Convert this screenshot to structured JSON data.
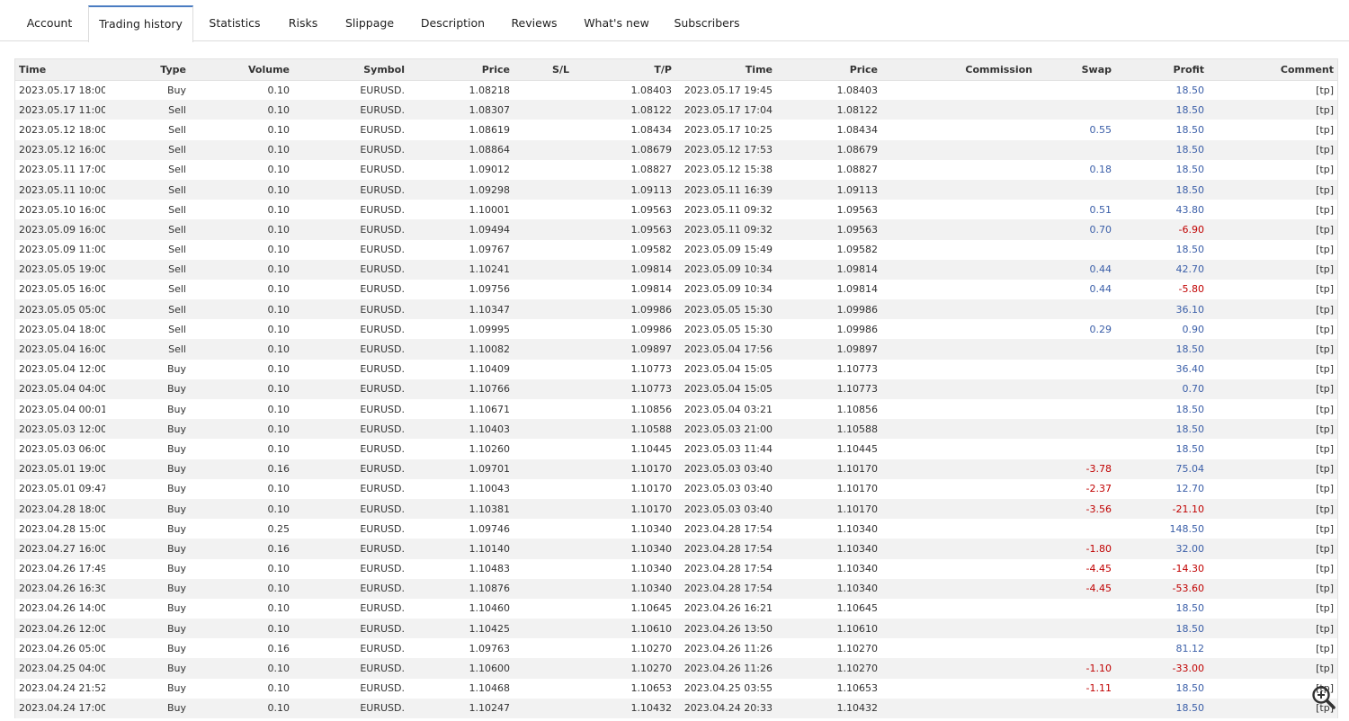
{
  "tabs": [
    {
      "label": "Account",
      "active": false
    },
    {
      "label": "Trading history",
      "active": true
    },
    {
      "label": "Statistics",
      "active": false
    },
    {
      "label": "Risks",
      "active": false
    },
    {
      "label": "Slippage",
      "active": false
    },
    {
      "label": "Description",
      "active": false
    },
    {
      "label": "Reviews",
      "active": false
    },
    {
      "label": "What's new",
      "active": false
    },
    {
      "label": "Subscribers",
      "active": false
    }
  ],
  "table": {
    "columns": [
      "Time",
      "Type",
      "Volume",
      "Symbol",
      "Price",
      "S/L",
      "T/P",
      "Time",
      "Price",
      "Commission",
      "Swap",
      "Profit",
      "Comment"
    ],
    "rows": [
      [
        "2023.05.17 18:00",
        "Buy",
        "0.10",
        "EURUSD.",
        "1.08218",
        "",
        "1.08403",
        "2023.05.17 19:45",
        "1.08403",
        "",
        "",
        "18.50",
        "[tp]"
      ],
      [
        "2023.05.17 11:00",
        "Sell",
        "0.10",
        "EURUSD.",
        "1.08307",
        "",
        "1.08122",
        "2023.05.17 17:04",
        "1.08122",
        "",
        "",
        "18.50",
        "[tp]"
      ],
      [
        "2023.05.12 18:00",
        "Sell",
        "0.10",
        "EURUSD.",
        "1.08619",
        "",
        "1.08434",
        "2023.05.17 10:25",
        "1.08434",
        "",
        "0.55",
        "18.50",
        "[tp]"
      ],
      [
        "2023.05.12 16:00",
        "Sell",
        "0.10",
        "EURUSD.",
        "1.08864",
        "",
        "1.08679",
        "2023.05.12 17:53",
        "1.08679",
        "",
        "",
        "18.50",
        "[tp]"
      ],
      [
        "2023.05.11 17:00",
        "Sell",
        "0.10",
        "EURUSD.",
        "1.09012",
        "",
        "1.08827",
        "2023.05.12 15:38",
        "1.08827",
        "",
        "0.18",
        "18.50",
        "[tp]"
      ],
      [
        "2023.05.11 10:00",
        "Sell",
        "0.10",
        "EURUSD.",
        "1.09298",
        "",
        "1.09113",
        "2023.05.11 16:39",
        "1.09113",
        "",
        "",
        "18.50",
        "[tp]"
      ],
      [
        "2023.05.10 16:00",
        "Sell",
        "0.10",
        "EURUSD.",
        "1.10001",
        "",
        "1.09563",
        "2023.05.11 09:32",
        "1.09563",
        "",
        "0.51",
        "43.80",
        "[tp]"
      ],
      [
        "2023.05.09 16:00",
        "Sell",
        "0.10",
        "EURUSD.",
        "1.09494",
        "",
        "1.09563",
        "2023.05.11 09:32",
        "1.09563",
        "",
        "0.70",
        "-6.90",
        "[tp]"
      ],
      [
        "2023.05.09 11:00",
        "Sell",
        "0.10",
        "EURUSD.",
        "1.09767",
        "",
        "1.09582",
        "2023.05.09 15:49",
        "1.09582",
        "",
        "",
        "18.50",
        "[tp]"
      ],
      [
        "2023.05.05 19:00",
        "Sell",
        "0.10",
        "EURUSD.",
        "1.10241",
        "",
        "1.09814",
        "2023.05.09 10:34",
        "1.09814",
        "",
        "0.44",
        "42.70",
        "[tp]"
      ],
      [
        "2023.05.05 16:00",
        "Sell",
        "0.10",
        "EURUSD.",
        "1.09756",
        "",
        "1.09814",
        "2023.05.09 10:34",
        "1.09814",
        "",
        "0.44",
        "-5.80",
        "[tp]"
      ],
      [
        "2023.05.05 05:00",
        "Sell",
        "0.10",
        "EURUSD.",
        "1.10347",
        "",
        "1.09986",
        "2023.05.05 15:30",
        "1.09986",
        "",
        "",
        "36.10",
        "[tp]"
      ],
      [
        "2023.05.04 18:00",
        "Sell",
        "0.10",
        "EURUSD.",
        "1.09995",
        "",
        "1.09986",
        "2023.05.05 15:30",
        "1.09986",
        "",
        "0.29",
        "0.90",
        "[tp]"
      ],
      [
        "2023.05.04 16:00",
        "Sell",
        "0.10",
        "EURUSD.",
        "1.10082",
        "",
        "1.09897",
        "2023.05.04 17:56",
        "1.09897",
        "",
        "",
        "18.50",
        "[tp]"
      ],
      [
        "2023.05.04 12:00",
        "Buy",
        "0.10",
        "EURUSD.",
        "1.10409",
        "",
        "1.10773",
        "2023.05.04 15:05",
        "1.10773",
        "",
        "",
        "36.40",
        "[tp]"
      ],
      [
        "2023.05.04 04:00",
        "Buy",
        "0.10",
        "EURUSD.",
        "1.10766",
        "",
        "1.10773",
        "2023.05.04 15:05",
        "1.10773",
        "",
        "",
        "0.70",
        "[tp]"
      ],
      [
        "2023.05.04 00:01",
        "Buy",
        "0.10",
        "EURUSD.",
        "1.10671",
        "",
        "1.10856",
        "2023.05.04 03:21",
        "1.10856",
        "",
        "",
        "18.50",
        "[tp]"
      ],
      [
        "2023.05.03 12:00",
        "Buy",
        "0.10",
        "EURUSD.",
        "1.10403",
        "",
        "1.10588",
        "2023.05.03 21:00",
        "1.10588",
        "",
        "",
        "18.50",
        "[tp]"
      ],
      [
        "2023.05.03 06:00",
        "Buy",
        "0.10",
        "EURUSD.",
        "1.10260",
        "",
        "1.10445",
        "2023.05.03 11:44",
        "1.10445",
        "",
        "",
        "18.50",
        "[tp]"
      ],
      [
        "2023.05.01 19:00",
        "Buy",
        "0.16",
        "EURUSD.",
        "1.09701",
        "",
        "1.10170",
        "2023.05.03 03:40",
        "1.10170",
        "",
        "-3.78",
        "75.04",
        "[tp]"
      ],
      [
        "2023.05.01 09:47",
        "Buy",
        "0.10",
        "EURUSD.",
        "1.10043",
        "",
        "1.10170",
        "2023.05.03 03:40",
        "1.10170",
        "",
        "-2.37",
        "12.70",
        "[tp]"
      ],
      [
        "2023.04.28 18:00",
        "Buy",
        "0.10",
        "EURUSD.",
        "1.10381",
        "",
        "1.10170",
        "2023.05.03 03:40",
        "1.10170",
        "",
        "-3.56",
        "-21.10",
        "[tp]"
      ],
      [
        "2023.04.28 15:00",
        "Buy",
        "0.25",
        "EURUSD.",
        "1.09746",
        "",
        "1.10340",
        "2023.04.28 17:54",
        "1.10340",
        "",
        "",
        "148.50",
        "[tp]"
      ],
      [
        "2023.04.27 16:00",
        "Buy",
        "0.16",
        "EURUSD.",
        "1.10140",
        "",
        "1.10340",
        "2023.04.28 17:54",
        "1.10340",
        "",
        "-1.80",
        "32.00",
        "[tp]"
      ],
      [
        "2023.04.26 17:49",
        "Buy",
        "0.10",
        "EURUSD.",
        "1.10483",
        "",
        "1.10340",
        "2023.04.28 17:54",
        "1.10340",
        "",
        "-4.45",
        "-14.30",
        "[tp]"
      ],
      [
        "2023.04.26 16:30",
        "Buy",
        "0.10",
        "EURUSD.",
        "1.10876",
        "",
        "1.10340",
        "2023.04.28 17:54",
        "1.10340",
        "",
        "-4.45",
        "-53.60",
        "[tp]"
      ],
      [
        "2023.04.26 14:00",
        "Buy",
        "0.10",
        "EURUSD.",
        "1.10460",
        "",
        "1.10645",
        "2023.04.26 16:21",
        "1.10645",
        "",
        "",
        "18.50",
        "[tp]"
      ],
      [
        "2023.04.26 12:00",
        "Buy",
        "0.10",
        "EURUSD.",
        "1.10425",
        "",
        "1.10610",
        "2023.04.26 13:50",
        "1.10610",
        "",
        "",
        "18.50",
        "[tp]"
      ],
      [
        "2023.04.26 05:00",
        "Buy",
        "0.16",
        "EURUSD.",
        "1.09763",
        "",
        "1.10270",
        "2023.04.26 11:26",
        "1.10270",
        "",
        "",
        "81.12",
        "[tp]"
      ],
      [
        "2023.04.25 04:00",
        "Buy",
        "0.10",
        "EURUSD.",
        "1.10600",
        "",
        "1.10270",
        "2023.04.26 11:26",
        "1.10270",
        "",
        "-1.10",
        "-33.00",
        "[tp]"
      ],
      [
        "2023.04.24 21:52",
        "Buy",
        "0.10",
        "EURUSD.",
        "1.10468",
        "",
        "1.10653",
        "2023.04.25 03:55",
        "1.10653",
        "",
        "-1.11",
        "18.50",
        "[tp]"
      ],
      [
        "2023.04.24 17:00",
        "Buy",
        "0.10",
        "EURUSD.",
        "1.10247",
        "",
        "1.10432",
        "2023.04.24 20:33",
        "1.10432",
        "",
        "",
        "18.50",
        "[tp]"
      ]
    ]
  },
  "colors": {
    "accent": "#4a7cc2",
    "positive": "#3a5ea8",
    "negative": "#c00000",
    "stripe": "#f2f2f2",
    "header": "#f0f0f0"
  },
  "icons": {
    "zoom": "magnifier-plus-icon"
  }
}
